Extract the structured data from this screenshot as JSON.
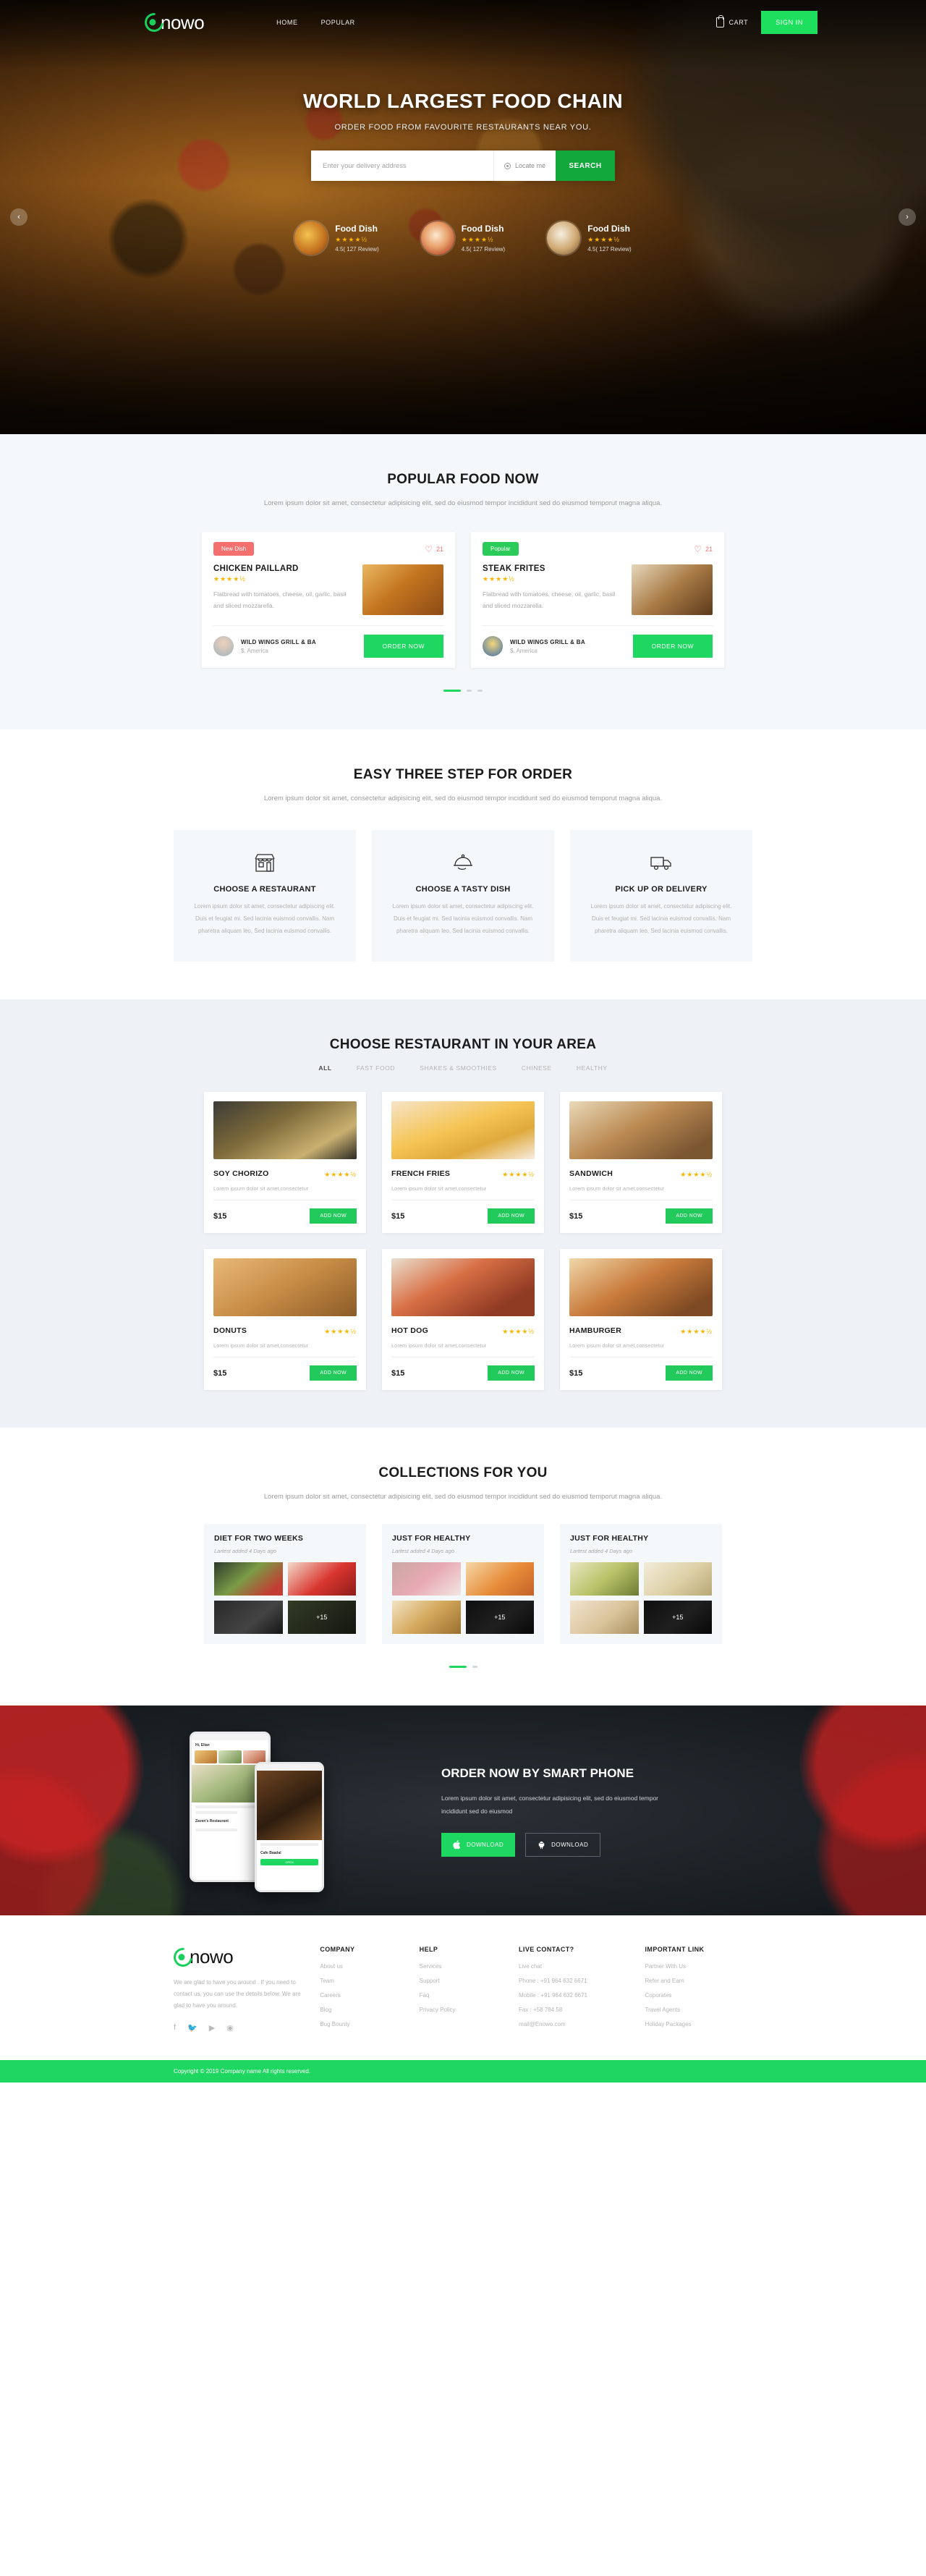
{
  "brand": {
    "name": "nowo",
    "logo_icon": "enowo-logo-icon"
  },
  "nav": {
    "links": [
      "HOME",
      "POPULAR"
    ],
    "cart_label": "CART",
    "cart_icon": "cart-icon",
    "signin_label": "SIGN IN"
  },
  "hero": {
    "title": "WORLD LARGEST FOOD CHAIN",
    "subtitle": "ORDER FOOD FROM FAVOURITE RESTAURANTS NEAR YOU.",
    "search_placeholder": "Enter your delivery address",
    "search_value": "",
    "locate_label": "Locate me",
    "locate_icon": "location-pin-icon",
    "search_button": "SEARCH",
    "prev_icon": "chevron-left-icon",
    "next_icon": "chevron-right-icon",
    "dishes": [
      {
        "name": "Food Dish",
        "stars": "★★★★½",
        "reviews": "4.5( 127 Review)"
      },
      {
        "name": "Food Dish",
        "stars": "★★★★½",
        "reviews": "4.5( 127 Review)"
      },
      {
        "name": "Food Dish",
        "stars": "★★★★½",
        "reviews": "4.5( 127 Review)"
      }
    ]
  },
  "popular": {
    "title": "POPULAR FOOD NOW",
    "subtitle": "Lorem ipsum dolor sit amet, consectetur adipisicing elit, sed do eiusmod tempor incididunt sed do eiusmod temporut magna aliqua.",
    "cards": [
      {
        "tag": "New Dish",
        "likes": "21",
        "heart_icon": "heart-icon",
        "name": "CHICKEN PAILLARD",
        "stars": "★★★★½",
        "desc": "Flatbread with tomatoes, cheese, oil, garlic, basil and sliced mozzarella.",
        "restaurant": "WILD WINGS GRILL & BA",
        "location": "$. America",
        "order_label": "ORDER NOW"
      },
      {
        "tag": "Popular",
        "likes": "21",
        "heart_icon": "heart-icon",
        "name": "STEAK FRITES",
        "stars": "★★★★½",
        "desc": "Flatbread with tomatoes, cheese, oil, garlic, basil and sliced mozzarella.",
        "restaurant": "WILD WINGS GRILL & BA",
        "location": "$. America",
        "order_label": "ORDER NOW"
      }
    ]
  },
  "steps": {
    "title": "EASY THREE STEP FOR ORDER",
    "subtitle": "Lorem ipsum dolor sit amet, consectetur adipisicing elit, sed do eiusmod tempor incididunt sed do eiusmod temporut magna aliqua.",
    "items": [
      {
        "icon": "storefront-icon",
        "name": "CHOOSE A RESTAURANT",
        "desc": "Lorem ipsum dolor sit amet, consectetur adipiscing elit. Duis et feugiat mi. Sed lacinia euismod convallis. Nam pharetra aliquam leo, Sed lacinia euismod convallis."
      },
      {
        "icon": "cloche-dish-icon",
        "name": "CHOOSE A TASTY DISH",
        "desc": "Lorem ipsum dolor sit amet, consectetur adipiscing elit. Duis et feugiat mi. Sed lacinia euismod convallis. Nam pharetra aliquam leo, Sed lacinia euismod convallis."
      },
      {
        "icon": "delivery-truck-icon",
        "name": "PICK UP OR DELIVERY",
        "desc": "Lorem ipsum dolor sit amet, consectetur adipiscing elit. Duis et feugiat mi. Sed lacinia euismod convallis. Nam pharetra aliquam leo, Sed lacinia euismod convallis."
      }
    ]
  },
  "restaurants": {
    "title": "CHOOSE RESTAURANT IN YOUR AREA",
    "tabs": [
      "ALL",
      "FAST FOOD",
      "SHAKES & SMOOTHIES",
      "CHINESE",
      "HEALTHY"
    ],
    "active_tab": "ALL",
    "items": [
      {
        "name": "SOY CHORIZO",
        "stars": "★★★★½",
        "desc": "Lorem ipsum dolor sit amet,consectetur",
        "price": "$15",
        "add_label": "ADD NOW"
      },
      {
        "name": "FRENCH FRIES",
        "stars": "★★★★½",
        "desc": "Lorem ipsum dolor sit amet,consectetur",
        "price": "$15",
        "add_label": "ADD NOW"
      },
      {
        "name": "SANDWICH",
        "stars": "★★★★½",
        "desc": "Lorem ipsum dolor sit amet,consectetur",
        "price": "$15",
        "add_label": "ADD NOW"
      },
      {
        "name": "DONUTS",
        "stars": "★★★★½",
        "desc": "Lorem ipsum dolor sit amet,consectetur",
        "price": "$15",
        "add_label": "ADD NOW"
      },
      {
        "name": "HOT DOG",
        "stars": "★★★★½",
        "desc": "Lorem ipsum dolor sit amet,consectetur",
        "price": "$15",
        "add_label": "ADD NOW"
      },
      {
        "name": "HAMBURGER",
        "stars": "★★★★½",
        "desc": "Lorem ipsum dolor sit amet,consectetur",
        "price": "$15",
        "add_label": "ADD NOW"
      }
    ]
  },
  "collections": {
    "title": "COLLECTIONS FOR YOU",
    "subtitle": "Lorem ipsum dolor sit amet, consectetur adipisicing elit, sed do eiusmod tempor incididunt sed do eiusmod temporut magna aliqua.",
    "items": [
      {
        "name": "DIET FOR TWO WEEKS",
        "meta": "Lartest added 4 Days ago",
        "more": "+15"
      },
      {
        "name": "JUST FOR HEALTHY",
        "meta": "Lartest added 4 Days ago",
        "more": "+15"
      },
      {
        "name": "JUST FOR HEALTHY",
        "meta": "Lartest added 4 Days ago",
        "more": "+15"
      }
    ]
  },
  "promo": {
    "title": "ORDER NOW BY SMART PHONE",
    "desc": "Lorem ipsum dolor sit amet, consectetur adipisicing elit, sed do eiusmod tempor incididunt sed do eiusmod",
    "ios_label": "DOWNLOAD",
    "ios_icon": "apple-icon",
    "android_label": "DOWNLOAD",
    "android_icon": "android-icon",
    "phone1_title": "Hi, Elian",
    "phone1_foot": "Zaven's Restaurant",
    "phone2_foot": "Cafe Baadal",
    "phone2_btn": "OPEN"
  },
  "footer": {
    "about": "We are glad to have you around . If you need to contact us, you can use the details below. We are glad to have you around.",
    "socials": [
      "facebook-icon",
      "twitter-icon",
      "youtube-icon",
      "dribbble-icon"
    ],
    "columns": [
      {
        "heading": "COMPANY",
        "links": [
          "About us",
          "Team",
          "Careers",
          "Blog",
          "Bug Bounty"
        ]
      },
      {
        "heading": "HELP",
        "links": [
          "Services",
          "Support",
          "Faq",
          "Privacy Policy"
        ]
      },
      {
        "heading": "LIVE CONTACT?",
        "links": [
          "Live chat",
          "Phone : +91 964 632 6671",
          "Mobile : +91 964 632 6671",
          "Fax : +58 784 58",
          "mail@Enowo.com"
        ]
      },
      {
        "heading": "IMPORTANT LINK",
        "links": [
          "Partner With Us",
          "Refer and Earn",
          "Coporates",
          "Travel Agents",
          "Holiday Packages"
        ]
      }
    ],
    "copyright": "Copyright © 2019 Company name All rights reserved."
  },
  "colors": {
    "accent": "#1ed760",
    "accent_dark": "#13a83c",
    "danger": "#f4706e",
    "star": "#f7b500"
  }
}
